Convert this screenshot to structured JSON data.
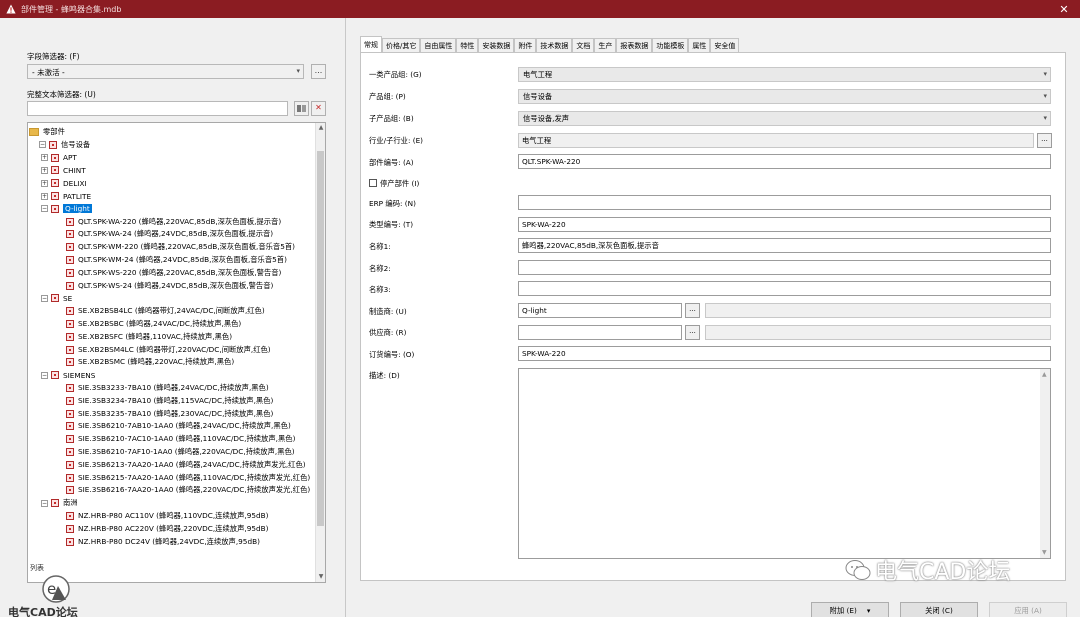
{
  "window": {
    "title": "部件管理 - 蜂鸣器合集.mdb",
    "close": "✕"
  },
  "left": {
    "field_filter_label": "字段筛选器: (F)",
    "field_filter_value": "- 未激活 -",
    "field_filter_dots": "...",
    "text_filter_label": "完整文本筛选器: (U)",
    "text_filter_value": "",
    "tree": {
      "root": "零部件",
      "group": "信号设备",
      "brands_top": [
        "APT",
        "CHINT",
        "DELIXI",
        "PATLITE"
      ],
      "qlight": "Q-light",
      "qlight_items": [
        "QLT.SPK-WA-220 (蜂鸣器,220VAC,85dB,深灰色面板,提示音)",
        "QLT.SPK-WA-24 (蜂鸣器,24VDC,85dB,深灰色面板,提示音)",
        "QLT.SPK-WM-220 (蜂鸣器,220VAC,85dB,深灰色面板,音乐音5首)",
        "QLT.SPK-WM-24 (蜂鸣器,24VDC,85dB,深灰色面板,音乐音5首)",
        "QLT.SPK-WS-220 (蜂鸣器,220VAC,85dB,深灰色面板,警告音)",
        "QLT.SPK-WS-24 (蜂鸣器,24VDC,85dB,深灰色面板,警告音)"
      ],
      "se": "SE",
      "se_items": [
        "SE.XB2BSB4LC (蜂鸣器带灯,24VAC/DC,间断放声,红色)",
        "SE.XB2BSBC (蜂鸣器,24VAC/DC,持续放声,黑色)",
        "SE.XB2BSFC (蜂鸣器,110VAC,持续放声,黑色)",
        "SE.XB2BSM4LC (蜂鸣器带灯,220VAC/DC,间断放声,红色)",
        "SE.XB2BSMC (蜂鸣器,220VAC,持续放声,黑色)"
      ],
      "siemens": "SIEMENS",
      "siemens_items": [
        "SIE.3SB3233-7BA10 (蜂鸣器,24VAC/DC,持续放声,黑色)",
        "SIE.3SB3234-7BA10 (蜂鸣器,115VAC/DC,持续放声,黑色)",
        "SIE.3SB3235-7BA10 (蜂鸣器,230VAC/DC,持续放声,黑色)",
        "SIE.3SB6210-7AB10-1AA0 (蜂鸣器,24VAC/DC,持续放声,黑色)",
        "SIE.3SB6210-7AC10-1AA0 (蜂鸣器,110VAC/DC,持续放声,黑色)",
        "SIE.3SB6210-7AF10-1AA0 (蜂鸣器,220VAC/DC,持续放声,黑色)",
        "SIE.3SB6213-7AA20-1AA0 (蜂鸣器,24VAC/DC,持续放声发光,红色)",
        "SIE.3SB6215-7AA20-1AA0 (蜂鸣器,110VAC/DC,持续放声发光,红色)",
        "SIE.3SB6216-7AA20-1AA0 (蜂鸣器,220VAC/DC,持续放声发光,红色)"
      ],
      "nz": "南洲",
      "nz_items": [
        "NZ.HRB-P80 AC110V (蜂鸣器,110VDC,连续放声,95dB)",
        "NZ.HRB-P80 AC220V (蜂鸣器,220VDC,连续放声,95dB)",
        "NZ.HRB-P80 DC24V (蜂鸣器,24VDC,连续放声,95dB)"
      ]
    },
    "list_label": "列表",
    "watermark_text": "电气CAD论坛"
  },
  "right": {
    "tabs": [
      "常规",
      "价格/其它",
      "自由属性",
      "特性",
      "安装数据",
      "附件",
      "技术数据",
      "文档",
      "生产",
      "报表数据",
      "功能模板",
      "属性",
      "安全值"
    ],
    "fields": {
      "cat1_label": "一类产品组: (G)",
      "cat1_value": "电气工程",
      "group_label": "产品组: (P)",
      "group_value": "信号设备",
      "subgroup_label": "子产品组: (B)",
      "subgroup_value": "信号设备,发声",
      "industry_label": "行业/子行业: (E)",
      "industry_value": "电气工程",
      "partno_label": "部件编号: (A)",
      "partno_value": "QLT.SPK-WA-220",
      "discontinued_label": "停产部件 (I)",
      "erp_label": "ERP 编码: (N)",
      "erp_value": "",
      "type_label": "类型编号: (T)",
      "type_value": "SPK-WA-220",
      "name1_label": "名称1:",
      "name1_value": "蜂鸣器,220VAC,85dB,深灰色面板,提示音",
      "name2_label": "名称2:",
      "name2_value": "",
      "name3_label": "名称3:",
      "name3_value": "",
      "mfr_label": "制造商: (U)",
      "mfr_value": "Q-light",
      "supplier_label": "供应商: (R)",
      "supplier_value": "",
      "order_label": "订货编号: (O)",
      "order_value": "SPK-WA-220",
      "desc_label": "描述: (D)"
    },
    "dots": "...",
    "buttons": {
      "extras": "附加 (E)",
      "close": "关闭 (C)",
      "apply": "应用 (A)"
    },
    "watermark_text": "电气CAD论坛"
  }
}
